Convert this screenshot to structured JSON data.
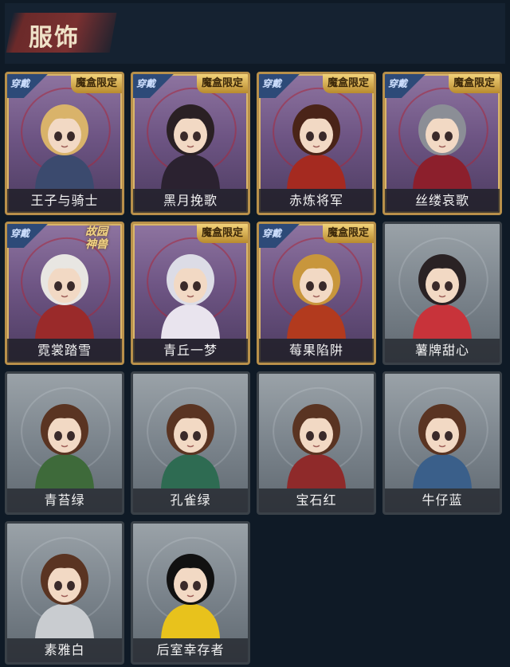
{
  "header": {
    "title": "服饰"
  },
  "badges": {
    "wear": "穿戴",
    "limited": "魔盒限定",
    "myth_line1": "故园",
    "myth_line2": "神兽"
  },
  "colors": {
    "purple_frame": "#b8904a",
    "grey_frame": "#3a4148",
    "background": "#0f1a26"
  },
  "costumes": [
    {
      "name": "王子与骑士",
      "style": "purple",
      "worn": true,
      "tag": "limited",
      "outfit": "#3b4a6e",
      "hair": "#d9b36a"
    },
    {
      "name": "黑月挽歌",
      "style": "purple",
      "worn": true,
      "tag": "limited",
      "outfit": "#2b2230",
      "hair": "#2a2024"
    },
    {
      "name": "赤炼将军",
      "style": "purple",
      "worn": true,
      "tag": "limited",
      "outfit": "#a52a20",
      "hair": "#4a2418"
    },
    {
      "name": "丝缕哀歌",
      "style": "purple",
      "worn": true,
      "tag": "limited",
      "outfit": "#8c1f2c",
      "hair": "#8b8e96"
    },
    {
      "name": "霓裳踏雪",
      "style": "purple",
      "worn": true,
      "tag": "myth",
      "outfit": "#9a2a2a",
      "hair": "#e8e6e2"
    },
    {
      "name": "青丘一梦",
      "style": "purple",
      "worn": false,
      "tag": "limited",
      "outfit": "#e9e4ee",
      "hair": "#dcdce6"
    },
    {
      "name": "莓果陷阱",
      "style": "purple",
      "worn": true,
      "tag": "limited",
      "outfit": "#b23a1e",
      "hair": "#c8963c"
    },
    {
      "name": "薯牌甜心",
      "style": "grey",
      "worn": false,
      "tag": "none",
      "outfit": "#c8333a",
      "hair": "#2a2224"
    },
    {
      "name": "青苔绿",
      "style": "grey",
      "worn": false,
      "tag": "none",
      "outfit": "#3e6a3a",
      "hair": "#5a3422"
    },
    {
      "name": "孔雀绿",
      "style": "grey",
      "worn": false,
      "tag": "none",
      "outfit": "#2e6b52",
      "hair": "#5a3422"
    },
    {
      "name": "宝石红",
      "style": "grey",
      "worn": false,
      "tag": "none",
      "outfit": "#8f2a2a",
      "hair": "#5a3422"
    },
    {
      "name": "牛仔蓝",
      "style": "grey",
      "worn": false,
      "tag": "none",
      "outfit": "#3a5f8a",
      "hair": "#5a3422"
    },
    {
      "name": "素雅白",
      "style": "grey",
      "worn": false,
      "tag": "none",
      "outfit": "#c9ccd0",
      "hair": "#5a3422"
    },
    {
      "name": "后室幸存者",
      "style": "grey",
      "worn": false,
      "tag": "none",
      "outfit": "#e8c21c",
      "hair": "#111111"
    }
  ]
}
